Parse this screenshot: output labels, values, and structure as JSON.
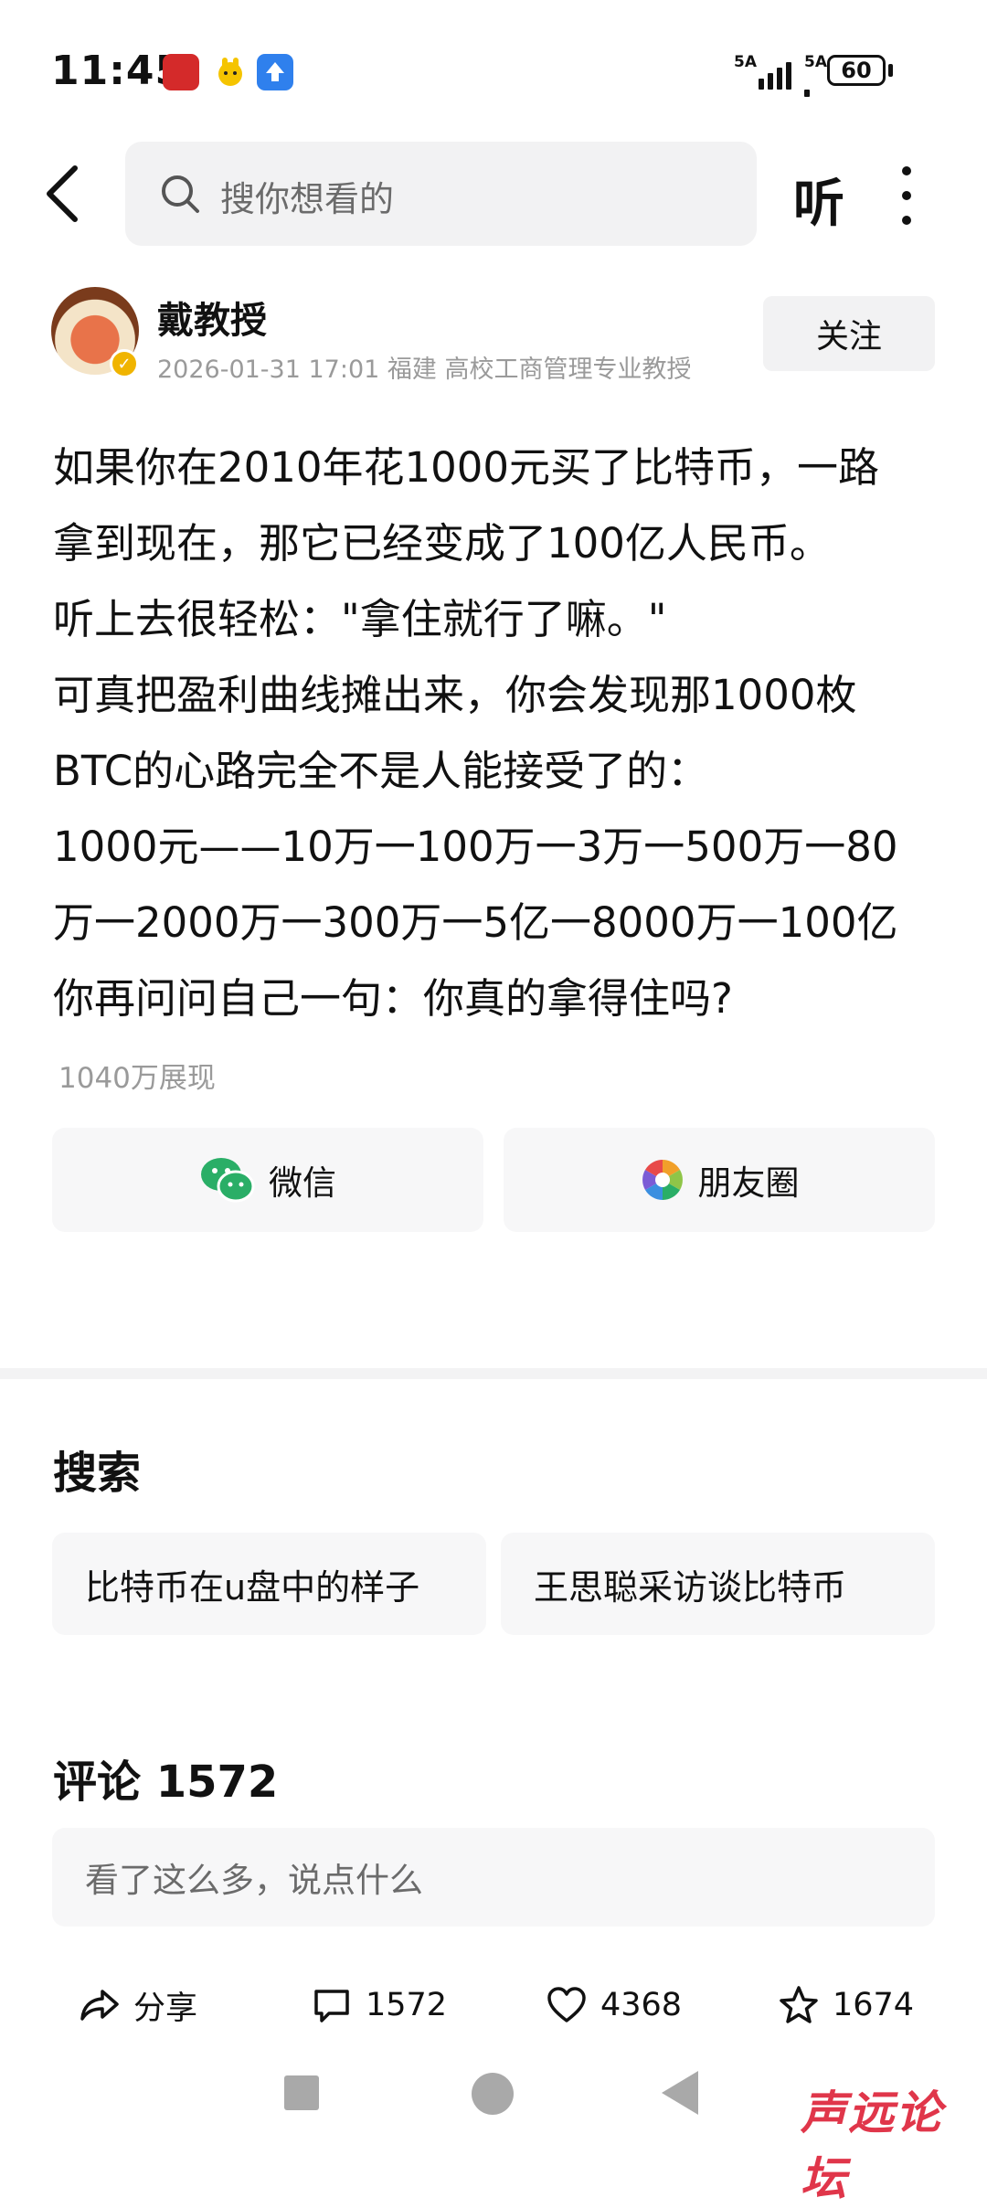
{
  "status_bar": {
    "time": "11:45",
    "signal1": "5A",
    "signal2": "5A",
    "battery": "60"
  },
  "nav": {
    "search_placeholder": "搜你想看的",
    "listen_label": "听"
  },
  "author": {
    "name": "戴教授",
    "meta": "2026-01-31 17:01 福建 高校工商管理专业教授",
    "follow_label": "关注"
  },
  "post": {
    "lines": [
      "如果你在2010年花1000元买了比特币，一路",
      "拿到现在，那它已经变成了100亿人民币。",
      "听上去很轻松：\"拿住就行了嘛。\"",
      "可真把盈利曲线摊出来，你会发现那1000枚",
      "BTC的心路完全不是人能接受了的：",
      "1000元——10万一100万一3万一500万一80",
      "万一2000万一300万一5亿一8000万一100亿",
      "你再问问自己一句：你真的拿得住吗?"
    ],
    "views": "1040万展现"
  },
  "share": {
    "wechat_label": "微信",
    "moments_label": "朋友圈"
  },
  "search_section": {
    "title": "搜索",
    "items": [
      "比特币在u盘中的样子",
      "王思聪采访谈比特币"
    ]
  },
  "comments": {
    "title": "评论 1572",
    "input_placeholder": "看了这么多，说点什么"
  },
  "actions": {
    "share_label": "分享",
    "comment_count": "1572",
    "like_count": "4368",
    "favorite_count": "1674"
  },
  "watermark": "声远论坛",
  "colors": {
    "accent_green": "#2aae67",
    "verified_badge": "#f0b400",
    "watermark": "#e0364a"
  }
}
